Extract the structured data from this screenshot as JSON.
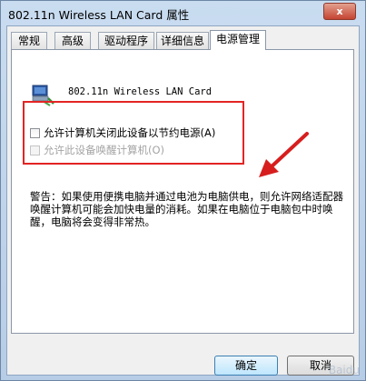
{
  "window": {
    "title": "802.11n Wireless LAN Card 属性",
    "close_label": "x"
  },
  "tabs": [
    {
      "label": "常规"
    },
    {
      "label": "高级"
    },
    {
      "label": "驱动程序"
    },
    {
      "label": "详细信息"
    },
    {
      "label": "电源管理",
      "active": true
    }
  ],
  "device": {
    "name": "802.11n Wireless LAN Card",
    "icon": "network-adapter-icon"
  },
  "options": {
    "allow_turn_off": {
      "label": "允许计算机关闭此设备以节约电源(A)",
      "checked": false,
      "enabled": true
    },
    "allow_wake": {
      "label": "允许此设备唤醒计算机(O)",
      "checked": false,
      "enabled": false
    }
  },
  "warning": "警告：如果使用便携电脑并通过电池为电脑供电，则允许网络适配器唤醒计算机可能会加快电量的消耗。如果在电脑位于电脑包中时唤醒，电脑将会变得非常热。",
  "buttons": {
    "ok": "确定",
    "cancel": "取消"
  },
  "annotation": {
    "highlight_color": "#e32424",
    "arrow_color": "#d71e1e"
  },
  "watermark_icons": [
    "baidu-jingyan-watermark"
  ]
}
